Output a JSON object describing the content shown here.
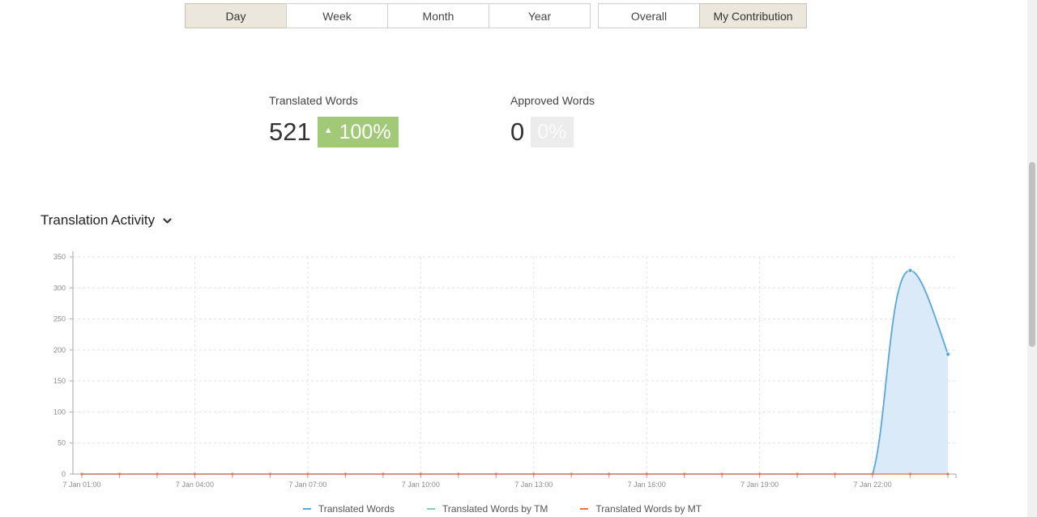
{
  "period_tabs": [
    {
      "label": "Day",
      "active": true
    },
    {
      "label": "Week",
      "active": false
    },
    {
      "label": "Month",
      "active": false
    },
    {
      "label": "Year",
      "active": false
    }
  ],
  "scope_tabs": [
    {
      "label": "Overall",
      "active": false
    },
    {
      "label": "My Contribution",
      "active": true
    }
  ],
  "stats": {
    "translated": {
      "label": "Translated Words",
      "value": "521",
      "change": "100%"
    },
    "approved": {
      "label": "Approved Words",
      "value": "0",
      "change": "0%"
    }
  },
  "section": {
    "title": "Translation Activity"
  },
  "chart_data": {
    "type": "area",
    "x_ticks": [
      "7 Jan 01:00",
      "7 Jan 04:00",
      "7 Jan 07:00",
      "7 Jan 10:00",
      "7 Jan 13:00",
      "7 Jan 16:00",
      "7 Jan 19:00",
      "7 Jan 22:00"
    ],
    "x_hours": [
      1,
      2,
      3,
      4,
      5,
      6,
      7,
      8,
      9,
      10,
      11,
      12,
      13,
      14,
      15,
      16,
      17,
      18,
      19,
      20,
      21,
      22,
      23,
      24
    ],
    "ylim": [
      0,
      350
    ],
    "y_ticks": [
      0,
      50,
      100,
      150,
      200,
      250,
      300,
      350
    ],
    "grid": true,
    "legend_position": "bottom",
    "series": [
      {
        "name": "Translated Words",
        "color": "#5aa7dc",
        "values": [
          0,
          0,
          0,
          0,
          0,
          0,
          0,
          0,
          0,
          0,
          0,
          0,
          0,
          0,
          0,
          0,
          0,
          0,
          0,
          0,
          0,
          0,
          328,
          193
        ]
      },
      {
        "name": "Translated Words by TM",
        "color": "#7fcfb2",
        "values": [
          0,
          0,
          0,
          0,
          0,
          0,
          0,
          0,
          0,
          0,
          0,
          0,
          0,
          0,
          0,
          0,
          0,
          0,
          0,
          0,
          0,
          0,
          0,
          0
        ]
      },
      {
        "name": "Translated Words by MT",
        "color": "#e8784a",
        "values": [
          0,
          0,
          0,
          0,
          0,
          0,
          0,
          0,
          0,
          0,
          0,
          0,
          0,
          0,
          0,
          0,
          0,
          0,
          0,
          0,
          0,
          0,
          0,
          0
        ]
      }
    ]
  }
}
